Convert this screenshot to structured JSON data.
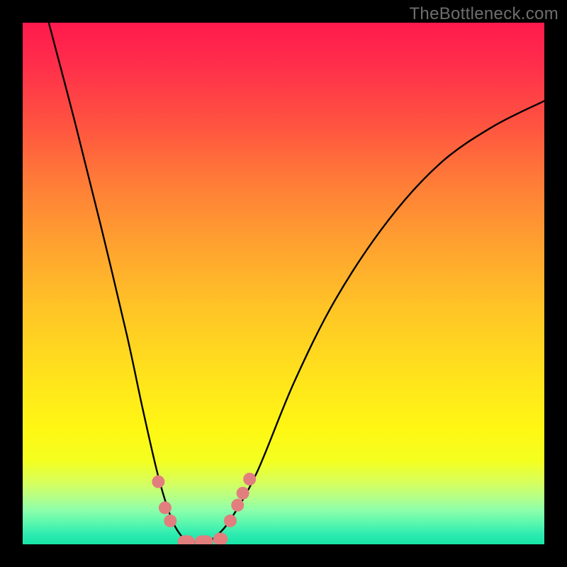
{
  "watermark": "TheBottleneck.com",
  "chart_data": {
    "type": "line",
    "title": "",
    "xlabel": "",
    "ylabel": "",
    "xlim": [
      0,
      100
    ],
    "ylim": [
      0,
      100
    ],
    "background_gradient_meaning": "top = high bottleneck (red), bottom = low bottleneck (green)",
    "series": [
      {
        "name": "bottleneck-curve",
        "x": [
          5,
          10,
          15,
          20,
          23,
          26,
          28.5,
          30.5,
          32,
          35,
          37,
          40,
          45,
          52,
          60,
          70,
          80,
          90,
          100
        ],
        "y": [
          100,
          81,
          61,
          40,
          26,
          13,
          5,
          1.5,
          0.5,
          0.5,
          1.5,
          5,
          14,
          31,
          47,
          62,
          73,
          80,
          85
        ]
      }
    ],
    "markers": [
      {
        "name": "dot",
        "x": 26.0,
        "y": 12.0
      },
      {
        "name": "dot",
        "x": 27.3,
        "y": 7.0
      },
      {
        "name": "dot",
        "x": 28.3,
        "y": 4.5
      },
      {
        "name": "dot",
        "x": 39.8,
        "y": 4.5
      },
      {
        "name": "dot",
        "x": 41.2,
        "y": 7.5
      },
      {
        "name": "dot",
        "x": 42.2,
        "y": 9.8
      },
      {
        "name": "dot",
        "x": 43.5,
        "y": 12.5
      },
      {
        "name": "pill",
        "x0": 29.7,
        "x1": 33.0,
        "y": 0.5
      },
      {
        "name": "pill",
        "x0": 33.0,
        "x1": 36.5,
        "y": 0.5
      },
      {
        "name": "pill",
        "x0": 36.5,
        "x1": 39.3,
        "y": 1.0
      }
    ]
  }
}
